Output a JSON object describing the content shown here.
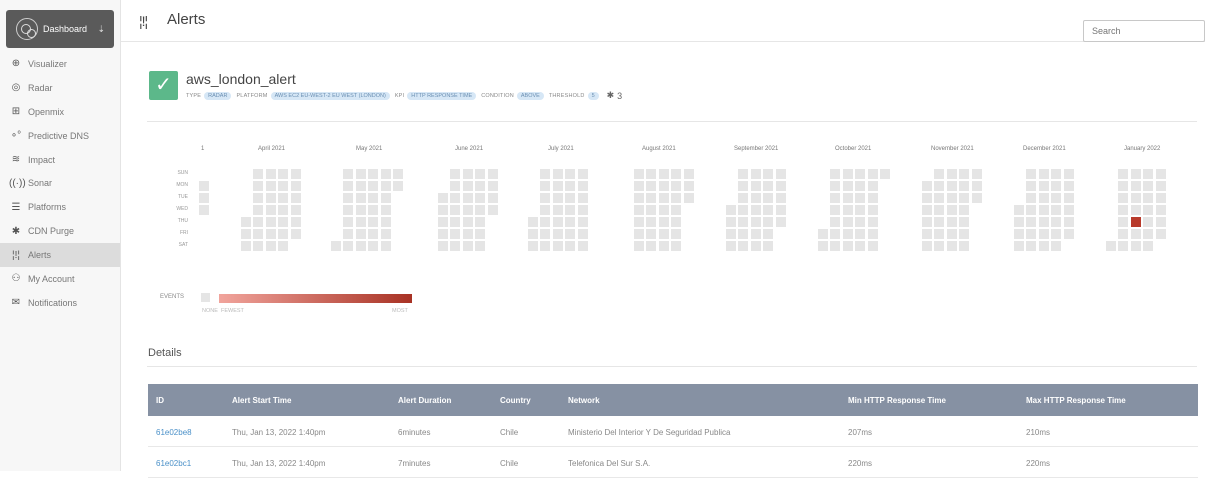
{
  "sidebar": {
    "dashboard_label": "Dashboard",
    "pin_icon": "pin-icon",
    "items": [
      {
        "label": "Visualizer",
        "icon": "⊕",
        "icon_name": "globe-icon"
      },
      {
        "label": "Radar",
        "icon": "◎",
        "icon_name": "radar-icon"
      },
      {
        "label": "Openmix",
        "icon": "⊞",
        "icon_name": "openmix-icon"
      },
      {
        "label": "Predictive DNS",
        "icon": "∘°",
        "icon_name": "predictive-dns-icon"
      },
      {
        "label": "Impact",
        "icon": "≋",
        "icon_name": "impact-icon"
      },
      {
        "label": "Sonar",
        "icon": "((·))",
        "icon_name": "sonar-icon"
      },
      {
        "label": "Platforms",
        "icon": "☰",
        "icon_name": "platforms-icon"
      },
      {
        "label": "CDN Purge",
        "icon": "✱",
        "icon_name": "cdn-purge-icon"
      },
      {
        "label": "Alerts",
        "icon": "¦!¦",
        "icon_name": "alerts-icon",
        "active": true
      },
      {
        "label": "My Account",
        "icon": "⚇",
        "icon_name": "account-icon"
      },
      {
        "label": "Notifications",
        "icon": "✉",
        "icon_name": "mail-icon"
      }
    ]
  },
  "topbar": {
    "icon": "¦!¦",
    "title": "Alerts",
    "search_placeholder": "Search"
  },
  "alert": {
    "name": "aws_london_alert",
    "status_icon": "✓",
    "meta": [
      {
        "key": "TYPE",
        "value": "RADAR"
      },
      {
        "key": "PLATFORM",
        "value": "AWS EC2 EU-WEST-2 EU WEST (LONDON)"
      },
      {
        "key": "KPI",
        "value": "HTTP RESPONSE TIME"
      },
      {
        "key": "CONDITION",
        "value": "ABOVE"
      },
      {
        "key": "THRESHOLD",
        "value": "5"
      }
    ],
    "count_icon": "✱",
    "count": "3"
  },
  "calendar": {
    "first_month_fragment": "1",
    "months": [
      "April 2021",
      "May 2021",
      "June 2021",
      "July 2021",
      "August 2021",
      "September 2021",
      "October 2021",
      "November 2021",
      "December 2021",
      "January 2022"
    ],
    "days": [
      "SUN",
      "MON",
      "TUE",
      "WED",
      "THU",
      "FRI",
      "SAT"
    ],
    "event_day": {
      "month": "January 2022",
      "week": 2,
      "day": "THU",
      "count": 1
    }
  },
  "legend": {
    "label": "EVENTS",
    "none": "NONE",
    "fewest": "FEWEST",
    "most": "MOST"
  },
  "details": {
    "title": "Details",
    "columns": [
      "ID",
      "Alert Start Time",
      "Alert Duration",
      "Country",
      "Network",
      "Min HTTP Response Time",
      "Max HTTP Response Time"
    ],
    "rows": [
      [
        "61e02be8",
        "Thu, Jan 13, 2022 1:40pm",
        "6minutes",
        "Chile",
        "Ministerio Del Interior Y De Seguridad Publica",
        "207ms",
        "210ms"
      ],
      [
        "61e02bc1",
        "Thu, Jan 13, 2022 1:40pm",
        "7minutes",
        "Chile",
        "Telefonica Del Sur S.A.",
        "220ms",
        "220ms"
      ]
    ]
  },
  "colors": {
    "status_ok": "#5cb88a",
    "event_hot": "#b83a2b",
    "table_header": "#8691a3",
    "link": "#4a90c8"
  }
}
